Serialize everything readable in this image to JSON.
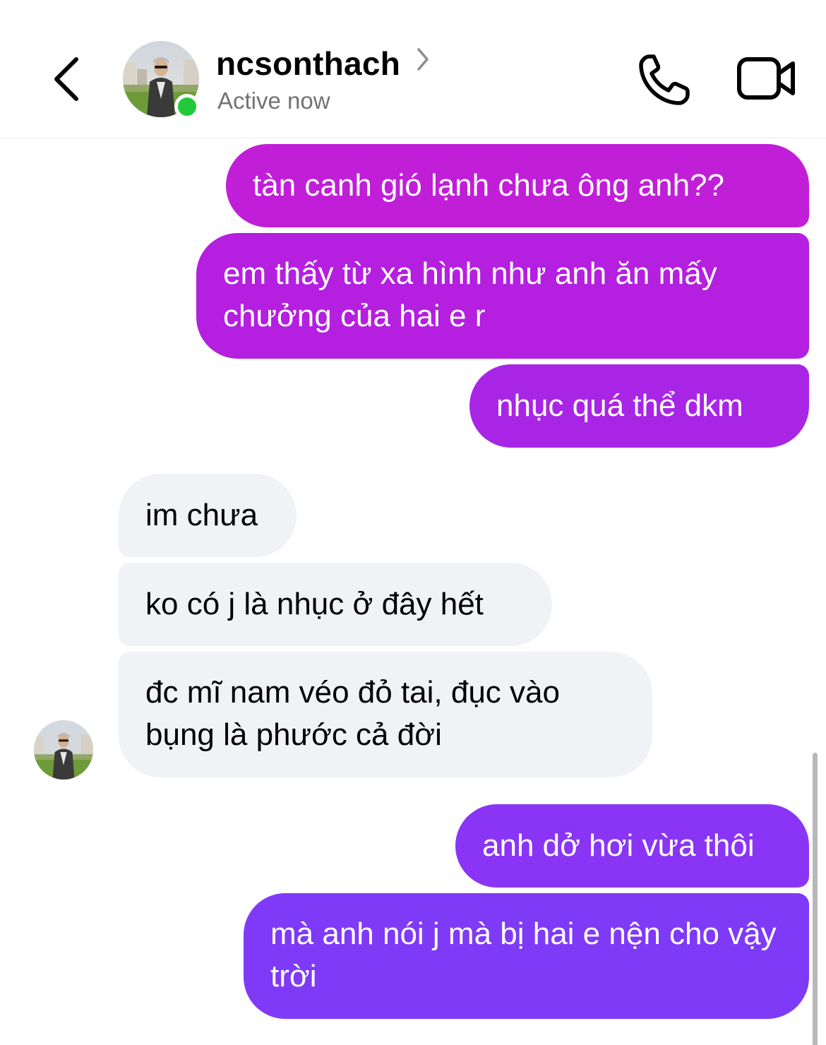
{
  "header": {
    "username": "ncsonthach",
    "status": "Active now",
    "back_icon": "chevron-left-icon",
    "profile_chevron_icon": "chevron-right-icon",
    "call_icon": "phone-icon",
    "video_icon": "video-camera-icon",
    "online_color": "#22c93a"
  },
  "messages": [
    {
      "direction": "outgoing",
      "text": "tàn canh gió lạnh chưa ông anh??"
    },
    {
      "direction": "outgoing",
      "text": "em thấy từ xa hình như anh ăn mấy chưởng của hai e r"
    },
    {
      "direction": "outgoing",
      "text": "nhục quá thể dkm"
    },
    {
      "direction": "incoming",
      "text": "im chưa"
    },
    {
      "direction": "incoming",
      "text": "ko có j là nhục ở đây hết"
    },
    {
      "direction": "incoming",
      "text": "đc mĩ nam véo đỏ tai, đục vào bụng là phước cả đời"
    },
    {
      "direction": "outgoing",
      "text": "anh dở hơi vừa thôi"
    },
    {
      "direction": "outgoing",
      "text": "mà anh nói j mà bị hai e nện cho vậy trời"
    }
  ],
  "colors": {
    "outgoing_gradient_top": "#c11ed8",
    "outgoing_gradient_bottom": "#7f3af7",
    "incoming_bubble": "#f0f2f5",
    "status_text": "#737373"
  }
}
